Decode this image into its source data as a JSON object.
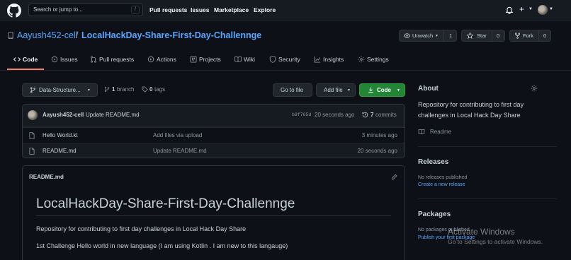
{
  "topbar": {
    "search_placeholder": "Search or jump to...",
    "search_shortcut": "/",
    "nav": [
      "Pull requests",
      "Issues",
      "Marketplace",
      "Explore"
    ],
    "plus_label": "+"
  },
  "repo": {
    "owner": "Aayush452-cell",
    "separator": "/",
    "name": "LocalHackDay-Share-First-Day-Challennge",
    "unwatch_label": "Unwatch",
    "unwatch_count": "1",
    "star_label": "Star",
    "star_count": "0",
    "fork_label": "Fork",
    "fork_count": "0"
  },
  "tabs": [
    {
      "label": "Code",
      "icon": "code-icon"
    },
    {
      "label": "Issues",
      "icon": "issue-icon"
    },
    {
      "label": "Pull requests",
      "icon": "pull-request-icon"
    },
    {
      "label": "Actions",
      "icon": "play-icon"
    },
    {
      "label": "Projects",
      "icon": "project-icon"
    },
    {
      "label": "Wiki",
      "icon": "book-icon"
    },
    {
      "label": "Security",
      "icon": "shield-icon"
    },
    {
      "label": "Insights",
      "icon": "graph-icon"
    },
    {
      "label": "Settings",
      "icon": "gear-icon"
    }
  ],
  "toolbar": {
    "branch": "Data-Structure...",
    "branch_count": "1",
    "branch_word": "branch",
    "tag_count": "0",
    "tag_word": "tags",
    "go_to_file": "Go to file",
    "add_file": "Add file",
    "code": "Code"
  },
  "latest_commit": {
    "author": "Aayush452-cell",
    "message": "Update README.md",
    "sha": "b8f765d",
    "time": "20 seconds ago",
    "commit_count": "7",
    "commit_word": "commits"
  },
  "files": [
    {
      "name": "Hello World.kt",
      "message": "Add files via upload",
      "time": "3 minutes ago"
    },
    {
      "name": "README.md",
      "message": "Update README.md",
      "time": "20 seconds ago"
    }
  ],
  "readme": {
    "header": "README.md",
    "title": "LocalHackDay-Share-First-Day-Challennge",
    "p1": "Repository for contributing to first day challenges in Local Hack Day Share",
    "p2": "1st Challenge Hello world in new language (I am using Kotlin . I am new to this langauge)"
  },
  "sidebar": {
    "about_title": "About",
    "about_line1": "Repository for contributing to first day",
    "about_line2": "challenges in Local Hack Day Share",
    "readme_link": "Readme",
    "releases_title": "Releases",
    "releases_none": "No releases published",
    "releases_link": "Create a new release",
    "packages_title": "Packages",
    "packages_none": "No packages published",
    "packages_link": "Publish your first package"
  },
  "watermark": {
    "line1": "Activate Windows",
    "line2": "Go to Settings to activate Windows."
  },
  "colors": {
    "accent_link": "#58a6ff",
    "code_button": "#238636",
    "tab_underline": "#f78166"
  }
}
